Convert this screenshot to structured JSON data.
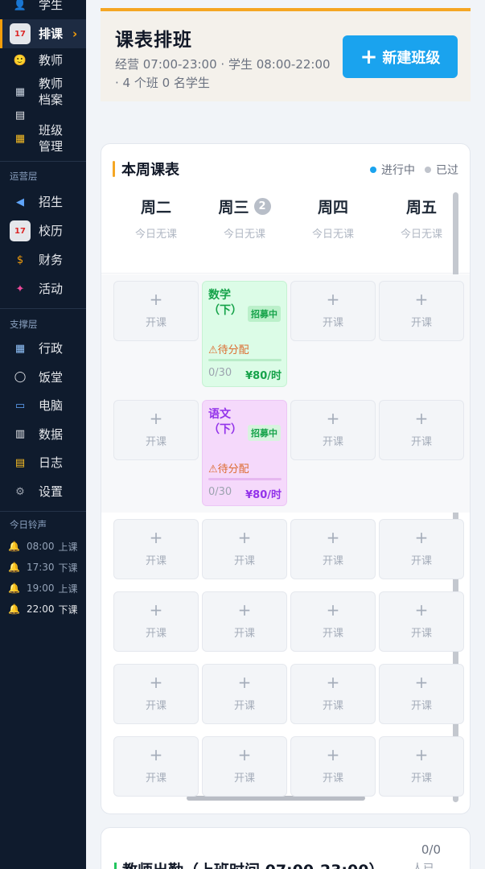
{
  "sidebar": {
    "items_top": [
      {
        "label": "学生",
        "icon": "student-icon",
        "color": "#dc2626",
        "glyph": "👤"
      },
      {
        "label": "排课",
        "icon": "calendar-icon",
        "color": "#e5e7eb",
        "glyph": "17",
        "active": true
      },
      {
        "label": "教师",
        "icon": "teacher-icon",
        "color": "#f59e0b",
        "glyph": "🙂"
      },
      {
        "label": "教师档案",
        "icon": "building-icon",
        "color": "#cbd5e1",
        "glyph": "▦"
      },
      {
        "label": "",
        "icon": "document-icon",
        "color": "#e5e7eb",
        "glyph": "▤"
      },
      {
        "label": "班级管理",
        "icon": "school-icon",
        "color": "#fbbf24",
        "glyph": "▦"
      }
    ],
    "section_ops": "运营层",
    "items_ops": [
      {
        "label": "招生",
        "icon": "megaphone-icon",
        "color": "#60a5fa",
        "glyph": "◀"
      },
      {
        "label": "校历",
        "icon": "calendar-icon",
        "color": "#e5e7eb",
        "glyph": "17"
      },
      {
        "label": "财务",
        "icon": "money-bag-icon",
        "color": "#f59e0b",
        "glyph": "$"
      },
      {
        "label": "活动",
        "icon": "party-popper-icon",
        "color": "#ec4899",
        "glyph": "✦"
      }
    ],
    "section_support": "支撑层",
    "items_support": [
      {
        "label": "行政",
        "icon": "office-building-icon",
        "color": "#93c5fd",
        "glyph": "▦"
      },
      {
        "label": "饭堂",
        "icon": "plate-icon",
        "color": "#e5e7eb",
        "glyph": "◯"
      },
      {
        "label": "电脑",
        "icon": "computer-icon",
        "color": "#60a5fa",
        "glyph": "▭"
      },
      {
        "label": "数据",
        "icon": "bar-chart-icon",
        "color": "#e5e7eb",
        "glyph": "▥"
      },
      {
        "label": "日志",
        "icon": "clipboard-icon",
        "color": "#fbbf24",
        "glyph": "▤"
      },
      {
        "label": "设置",
        "icon": "gear-icon",
        "color": "#9ca3af",
        "glyph": "⚙"
      }
    ],
    "section_bells": "今日铃声",
    "bells": [
      {
        "time": "08:00",
        "label": "上课"
      },
      {
        "time": "17:30",
        "label": "下课"
      },
      {
        "time": "19:00",
        "label": "上课"
      },
      {
        "time": "22:00",
        "label": "下课"
      }
    ]
  },
  "header": {
    "title": "课表排班",
    "subtitle": "经营 07:00-23:00 · 学生 08:00-22:00 · 4 个班 0 名学生",
    "new_button": "新建班级",
    "new_button_icon": "plus-icon"
  },
  "schedule": {
    "title": "本周课表",
    "legend": [
      {
        "label": "进行中",
        "color": "#1aa3ee"
      },
      {
        "label": "已过",
        "color": "#c0c4cc"
      }
    ],
    "days": [
      {
        "name": "周二",
        "sub": "今日无课",
        "badge": ""
      },
      {
        "name": "周三",
        "sub": "今日无课",
        "badge": "2"
      },
      {
        "name": "周四",
        "sub": "今日无课",
        "badge": ""
      },
      {
        "name": "周五",
        "sub": "今日无课",
        "badge": ""
      }
    ],
    "slot_plus": "+",
    "slot_label": "开课",
    "courses": [
      {
        "name": "数学（下）",
        "badge": "招募中",
        "status": "⚠待分配",
        "count": "0/30",
        "price": "¥80/时",
        "type": "math",
        "row": 0,
        "col": 1
      },
      {
        "name": "语文（下）",
        "badge": "招募中",
        "status": "⚠待分配",
        "count": "0/30",
        "price": "¥80/时",
        "type": "chi",
        "row": 1,
        "col": 1
      }
    ]
  },
  "attendance": {
    "title": "教师出勤（上班时间 07:00-23:00）",
    "count": "0/0",
    "extra": "人已"
  },
  "colors": {
    "accent": "#f5a623",
    "primary": "#1aa3ee",
    "sidebar_bg": "#0f1b2d"
  }
}
